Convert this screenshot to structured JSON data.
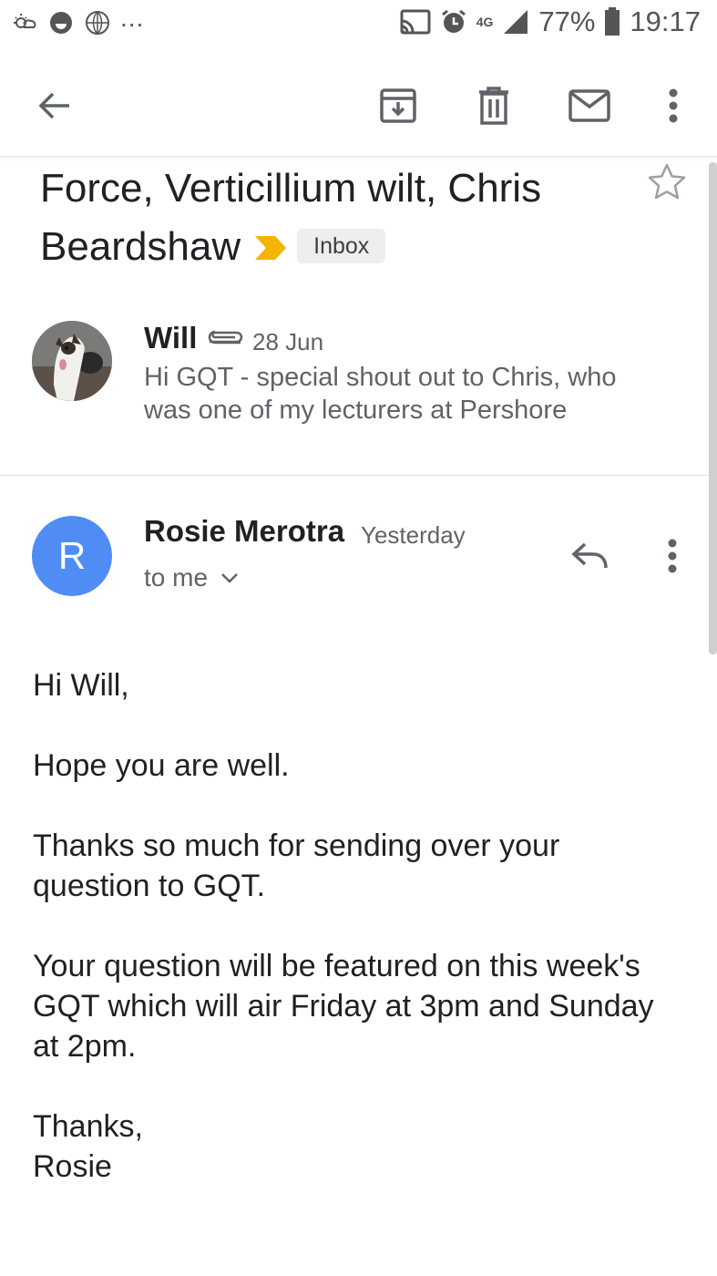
{
  "status_bar": {
    "battery": "77%",
    "time": "19:17",
    "network": "4G",
    "overflow": "...",
    "icons": [
      "weather-icon",
      "smiley-icon",
      "globe-icon",
      "cast-icon",
      "alarm-icon",
      "signal-icon",
      "battery-icon"
    ]
  },
  "toolbar": {
    "icons": [
      "back-arrow-icon",
      "archive-icon",
      "delete-icon",
      "mark-unread-icon",
      "more-vert-icon"
    ]
  },
  "subject": {
    "text": "Force, Verticillium wilt, Chris Beardshaw",
    "label": "Inbox",
    "importance_color": "#f4b400"
  },
  "collapsed_message": {
    "sender": "Will",
    "date": "28 Jun",
    "snippet": "Hi GQT - special shout out to Chris, who was one of my lecturers at Pershore"
  },
  "expanded_message": {
    "avatar_letter": "R",
    "avatar_color": "#4f8df5",
    "sender": "Rosie Merotra",
    "date": "Yesterday",
    "recipient": "to me",
    "body": [
      "Hi Will,",
      "Hope you are well.",
      "Thanks so much for sending over your question to GQT.",
      "Your question will be featured on this week's GQT which will air Friday at 3pm and Sunday at 2pm.",
      "Thanks,\nRosie"
    ]
  }
}
